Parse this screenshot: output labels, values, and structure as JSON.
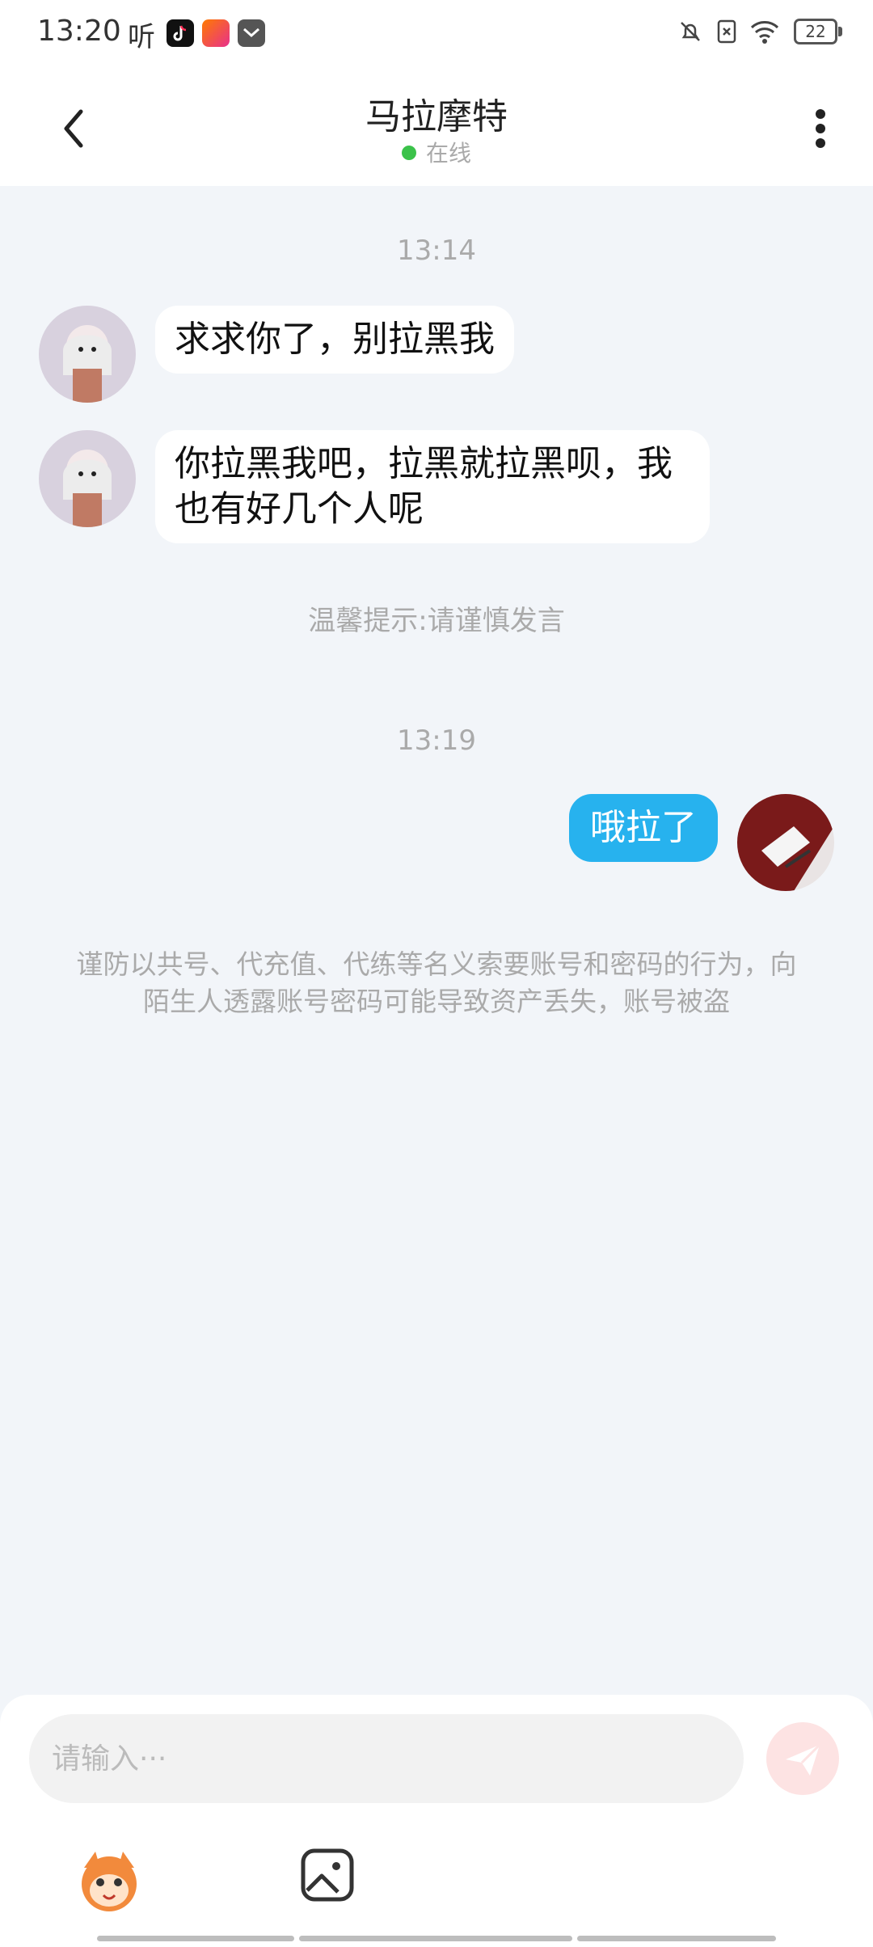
{
  "status_bar": {
    "time": "13:20",
    "ting_label": "听",
    "battery": "22"
  },
  "header": {
    "title": "马拉摩特",
    "online_status": "在线",
    "colors": {
      "online_dot": "#3bc24a"
    }
  },
  "messages": [
    {
      "type": "timestamp",
      "text": "13:14"
    },
    {
      "type": "incoming",
      "text": "求求你了，别拉黑我"
    },
    {
      "type": "incoming",
      "text": "你拉黑我吧，拉黑就拉黑呗，我也有好几个人呢"
    },
    {
      "type": "hint",
      "text": "温馨提示:请谨慎发言"
    },
    {
      "type": "timestamp",
      "text": "13:19"
    },
    {
      "type": "outgoing",
      "text": "哦拉了"
    }
  ],
  "warning": "谨防以共号、代充值、代练等名义索要账号和密码的行为，向陌生人透露账号密码可能导致资产丢失，账号被盗",
  "composer": {
    "placeholder": "请输入···",
    "colors": {
      "send_bg": "#fde3e3",
      "outgoing_bubble": "#27b2ee"
    }
  },
  "icons": [
    "back-arrow-icon",
    "more-vertical-icon",
    "send-icon",
    "emoji-mascot-icon",
    "image-icon",
    "bell-off-icon",
    "sim-off-icon",
    "wifi-icon"
  ]
}
